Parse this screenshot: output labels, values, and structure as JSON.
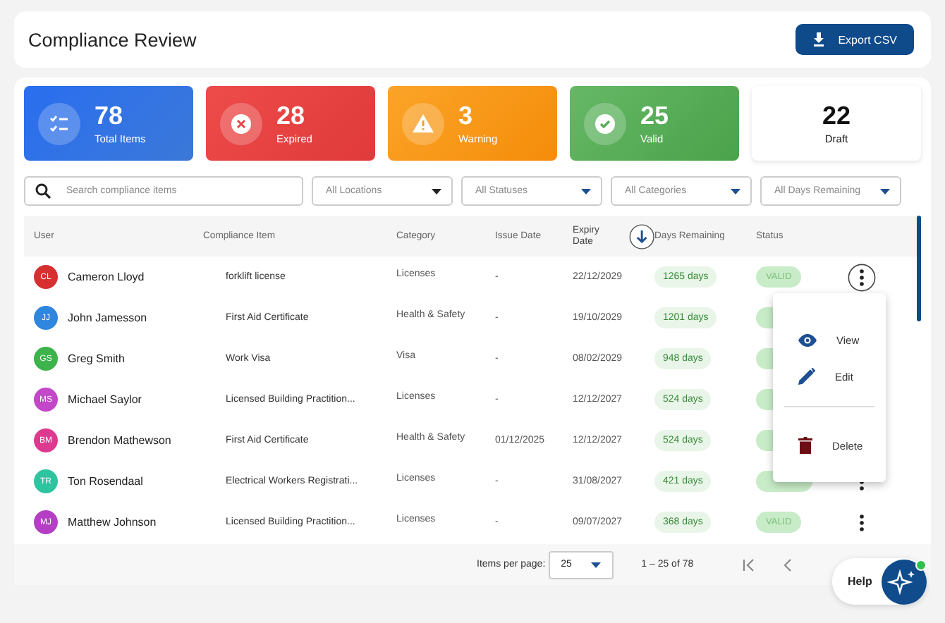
{
  "header": {
    "title": "Compliance Review",
    "export_button": "Export CSV"
  },
  "stats": [
    {
      "kind": "total",
      "value": "78",
      "label": "Total Items"
    },
    {
      "kind": "expired",
      "value": "28",
      "label": "Expired"
    },
    {
      "kind": "warning",
      "value": "3",
      "label": "Warning"
    },
    {
      "kind": "valid",
      "value": "25",
      "label": "Valid"
    },
    {
      "kind": "draft",
      "value": "22",
      "label": "Draft"
    }
  ],
  "search": {
    "placeholder": "Search compliance items"
  },
  "filters": [
    "All Locations",
    "All Statuses",
    "All Categories",
    "All Days Remaining"
  ],
  "table": {
    "columns": [
      {
        "label": "User",
        "sorted": false
      },
      {
        "label": "Compliance Item",
        "sorted": false
      },
      {
        "label": "Category",
        "sorted": false
      },
      {
        "label": "Issue Date",
        "sorted": false
      },
      {
        "label": "Expiry Date",
        "sorted": true
      },
      {
        "label": "Days Remaining",
        "sorted": false
      },
      {
        "label": "Status",
        "sorted": false
      }
    ],
    "rows": [
      {
        "initials": "CL",
        "color": "#d63031",
        "user": "Cameron Lloyd",
        "item": "forklift license",
        "category": "Licenses",
        "issue": "-",
        "expiry": "22/12/2029",
        "days": "1265 days",
        "status": "VALID",
        "menu_open": true
      },
      {
        "initials": "JJ",
        "color": "#2e86de",
        "user": "John Jamesson",
        "item": "First Aid Certificate",
        "category": "Health & Safety",
        "issue": "-",
        "expiry": "19/10/2029",
        "days": "1201 days"
      },
      {
        "initials": "GS",
        "color": "#3cb44b",
        "user": "Greg Smith",
        "item": "Work Visa",
        "category": "Visa",
        "issue": "-",
        "expiry": "08/02/2029",
        "days": "948 days"
      },
      {
        "initials": "MS",
        "color": "#c247c9",
        "user": "Michael Saylor",
        "item": "Licensed Building Practition...",
        "category": "Licenses",
        "issue": "-",
        "expiry": "12/12/2027",
        "days": "524 days"
      },
      {
        "initials": "BM",
        "color": "#dd3a8f",
        "user": "Brendon Mathewson",
        "item": "First Aid Certificate",
        "category": "Health & Safety",
        "issue": "01/12/2025",
        "expiry": "12/12/2027",
        "days": "524 days"
      },
      {
        "initials": "TR",
        "color": "#2ec4a0",
        "user": "Ton Rosendaal",
        "item": "Electrical Workers Registrati...",
        "category": "Licenses",
        "issue": "-",
        "expiry": "31/08/2027",
        "days": "421 days",
        "menu_open": false
      },
      {
        "initials": "MJ",
        "color": "#b43fc4",
        "user": "Matthew Johnson",
        "item": "Licensed Building Practition...",
        "category": "Licenses",
        "issue": "-",
        "expiry": "09/07/2027",
        "days": "368 days",
        "status": "VALID",
        "menu_open": false
      }
    ]
  },
  "row_menu": [
    {
      "kind": "view",
      "label": "View"
    },
    {
      "kind": "edit",
      "label": "Edit"
    },
    {
      "kind": "divider"
    },
    {
      "kind": "delete",
      "label": "Delete"
    }
  ],
  "pagination": {
    "items_per_page_label": "Items per page:",
    "items_per_page": "25",
    "range": "1 – 25 of 78"
  },
  "help": {
    "label": "Help",
    "online": true
  }
}
